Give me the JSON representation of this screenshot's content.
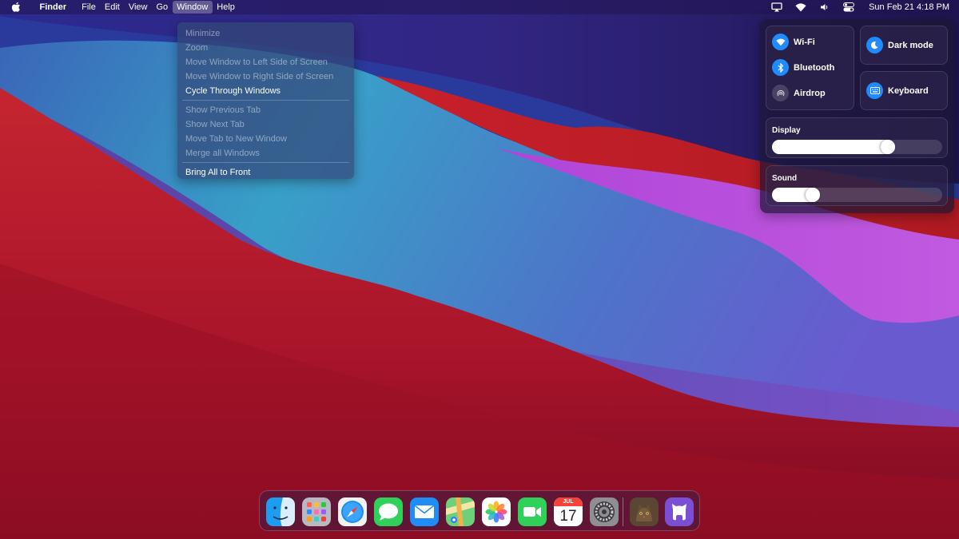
{
  "menubar": {
    "app_name": "Finder",
    "menus": [
      "File",
      "Edit",
      "View",
      "Go",
      "Window",
      "Help"
    ],
    "active_menu": "Window",
    "datetime": "Sun Feb 21  4:18 PM",
    "tray_icons": [
      "airplay-icon",
      "wifi-icon",
      "volume-icon",
      "control-center-icon"
    ]
  },
  "window_menu": {
    "items": [
      {
        "label": "Minimize",
        "enabled": false
      },
      {
        "label": "Zoom",
        "enabled": false
      },
      {
        "label": "Move Window to Left Side of Screen",
        "enabled": false
      },
      {
        "label": "Move Window to Right Side of Screen",
        "enabled": false
      },
      {
        "label": "Cycle Through Windows",
        "enabled": true
      },
      {
        "label": "Show Previous Tab",
        "enabled": false
      },
      {
        "label": "Show Next Tab",
        "enabled": false
      },
      {
        "label": "Move Tab to New Window",
        "enabled": false
      },
      {
        "label": "Merge all Windows",
        "enabled": false
      },
      {
        "label": "Bring All to Front",
        "enabled": true
      }
    ]
  },
  "control_center": {
    "wifi": {
      "label": "Wi-Fi",
      "on": true
    },
    "bluetooth": {
      "label": "Bluetooth",
      "on": true
    },
    "airdrop": {
      "label": "Airdrop",
      "on": false
    },
    "dark_mode": {
      "label": "Dark mode",
      "on": true
    },
    "keyboard": {
      "label": "Keyboard",
      "on": true
    },
    "display": {
      "label": "Display",
      "level_percent": 68
    },
    "sound": {
      "label": "Sound",
      "level_percent": 24
    },
    "accent_color": "#1f8bff"
  },
  "dock": {
    "apps": [
      "Finder",
      "Launchpad",
      "Safari",
      "Messages",
      "Mail",
      "Maps",
      "Photos",
      "FaceTime",
      "Calendar",
      "System Preferences"
    ],
    "others": [
      "Profile",
      "GitHub"
    ],
    "calendar_month": "JUL",
    "calendar_day": "17"
  }
}
